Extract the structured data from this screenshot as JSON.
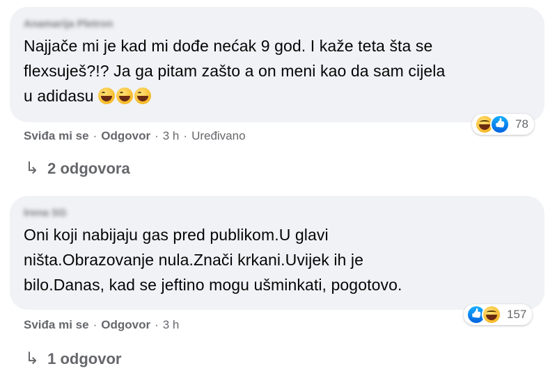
{
  "comments": [
    {
      "author": "Anamarija Pletron",
      "text": "Najjače mi je kad mi dođe nećak 9 god. I kaže teta šta se flexsuješ?!? Ja ga pitam zašto a on meni kao da sam cijela u adidasu",
      "text_line1": "Najjače mi je kad mi dođe nećak 9 god. I kaže teta šta se",
      "text_line2": "flexsuješ?!? Ja ga pitam zašto a on meni kao da sam cijela",
      "text_line3": "u adidasu",
      "emojis": [
        "grinning-sweat-icon",
        "grinning-sweat-icon",
        "grinning-sweat-icon"
      ],
      "reactions": [
        "haha",
        "like"
      ],
      "reaction_count": "78",
      "like_label": "Sviđa mi se",
      "reply_label": "Odgovor",
      "time": "3 h",
      "edited": "Uređivano",
      "replies_label": "2 odgovora"
    },
    {
      "author": "Irena SG",
      "text_line1": "Oni koji nabijaju gas pred publikom.U glavi",
      "text_line2": "ništa.Obrazovanje nula.Znači krkani.Uvijek ih je",
      "text_line3": "bilo.Danas, kad se jeftino mogu ušminkati, pogotovo.",
      "reactions": [
        "like",
        "haha"
      ],
      "reaction_count": "157",
      "like_label": "Sviđa mi se",
      "reply_label": "Odgovor",
      "time": "3 h",
      "replies_label": "1 odgovor"
    }
  ],
  "colors": {
    "bubble_bg": "#f0f2f5",
    "meta_text": "#65676b",
    "like_blue": "#0062df",
    "haha_yellow": "#f7b928"
  }
}
